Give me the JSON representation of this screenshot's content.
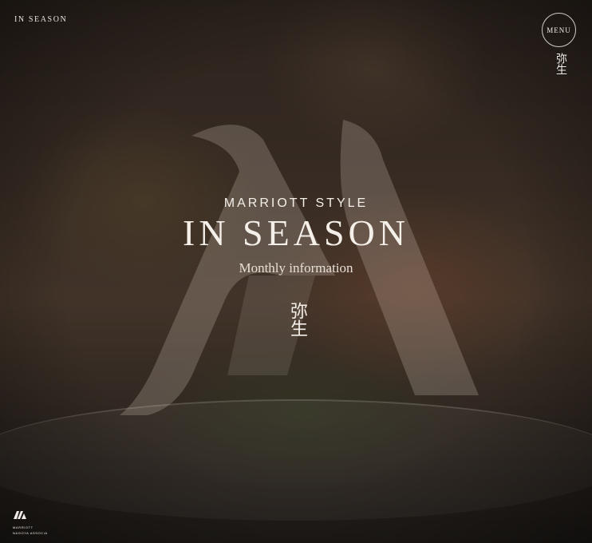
{
  "header": {
    "brand_label": "IN SEASON",
    "menu_label": "MENU",
    "month_label": "弥生"
  },
  "hero": {
    "eyebrow": "MARRIOTT STYLE",
    "title": "IN SEASON",
    "subtitle": "Monthly information",
    "month": "弥生"
  },
  "footer": {
    "logo_line1": "MARRIOTT",
    "logo_line2": "NAGOYA ASSOCIA"
  },
  "colors": {
    "text": "#f4efe9",
    "overlay_m": "#e7dccf"
  }
}
